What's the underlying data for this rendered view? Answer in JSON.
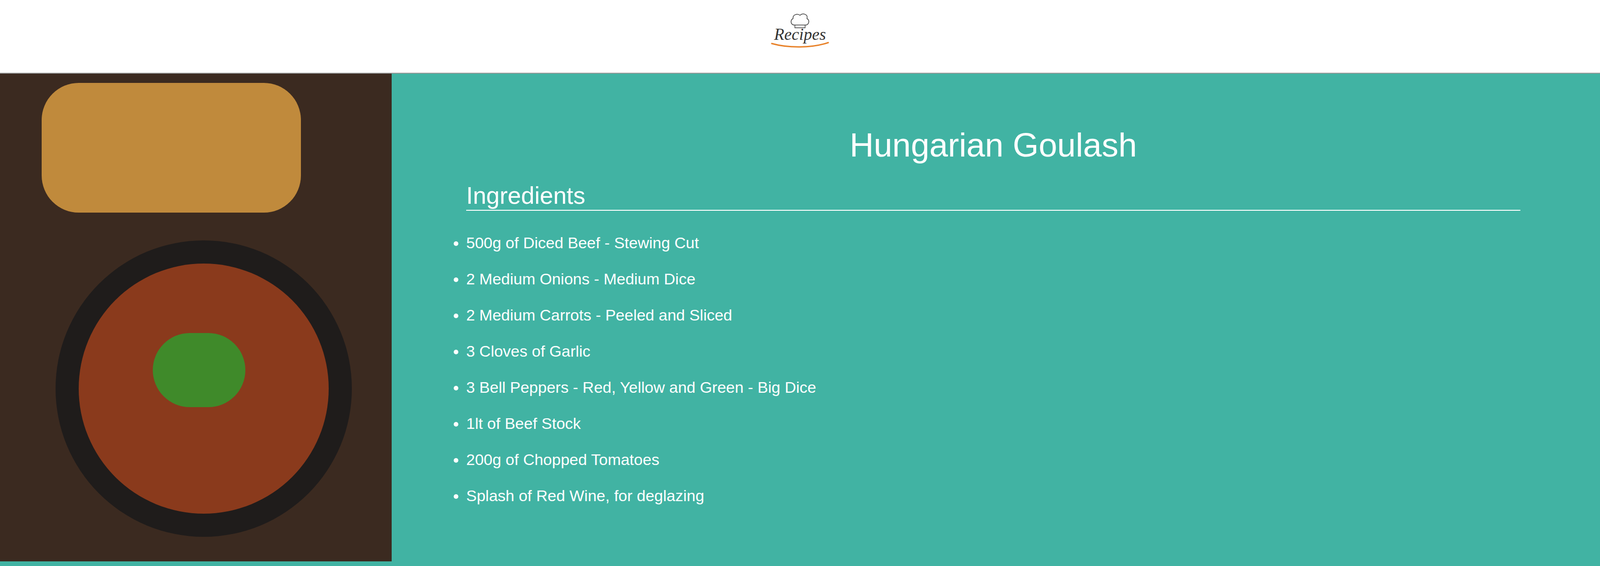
{
  "header": {
    "logo": {
      "text": "Recipes"
    }
  },
  "recipe": {
    "title": "Hungarian Goulash",
    "sections": [
      {
        "heading": "Ingredients",
        "items": [
          "500g of Diced Beef - Stewing Cut",
          "2 Medium Onions - Medium Dice",
          "2 Medium Carrots - Peeled and Sliced",
          "3 Cloves of Garlic",
          "3 Bell Peppers - Red, Yellow and Green - Big Dice",
          "1lt of Beef Stock",
          "200g of Chopped Tomatoes",
          "Splash of Red Wine, for deglazing"
        ]
      }
    ]
  }
}
